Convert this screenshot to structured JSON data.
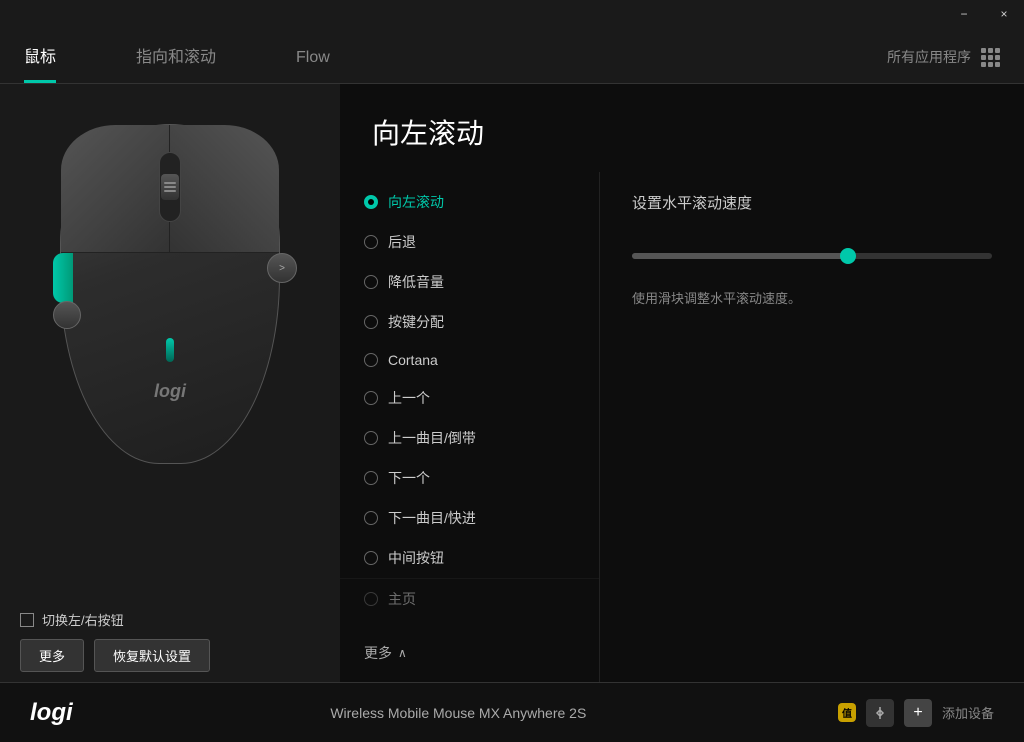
{
  "titlebar": {
    "minimize_label": "−",
    "close_label": "×"
  },
  "topnav": {
    "tabs": [
      {
        "id": "mouse",
        "label": "鼠标",
        "active": true
      },
      {
        "id": "pointer",
        "label": "指向和滚动",
        "active": false
      },
      {
        "id": "flow",
        "label": "Flow",
        "active": false
      }
    ],
    "all_apps": "所有应用程序"
  },
  "panel": {
    "title": "向左滚动",
    "options": [
      {
        "id": "scroll-left",
        "label": "向左滚动",
        "active": true
      },
      {
        "id": "back",
        "label": "后退",
        "active": false
      },
      {
        "id": "vol-down",
        "label": "降低音量",
        "active": false
      },
      {
        "id": "key-assign",
        "label": "按键分配",
        "active": false
      },
      {
        "id": "cortana",
        "label": "Cortana",
        "active": false
      },
      {
        "id": "prev",
        "label": "上一个",
        "active": false
      },
      {
        "id": "prev-track",
        "label": "上一曲目/倒带",
        "active": false
      },
      {
        "id": "next",
        "label": "下一个",
        "active": false
      },
      {
        "id": "next-track",
        "label": "下一曲目/快进",
        "active": false
      },
      {
        "id": "middle-btn",
        "label": "中间按钮",
        "active": false
      },
      {
        "id": "home",
        "label": "主页",
        "active": false
      }
    ],
    "more_btn": "更多",
    "settings_title": "设置水平滚动速度",
    "settings_desc": "使用滑块调整水平滚动速度。",
    "slider_value": 60
  },
  "bottom": {
    "checkbox_label": "切换左/右按钮",
    "btn_more": "更多",
    "btn_reset": "恢复默认设置"
  },
  "footer": {
    "logo": "logi",
    "device_name": "Wireless Mobile Mouse MX Anywhere 2S",
    "add_device": "添加设备"
  }
}
